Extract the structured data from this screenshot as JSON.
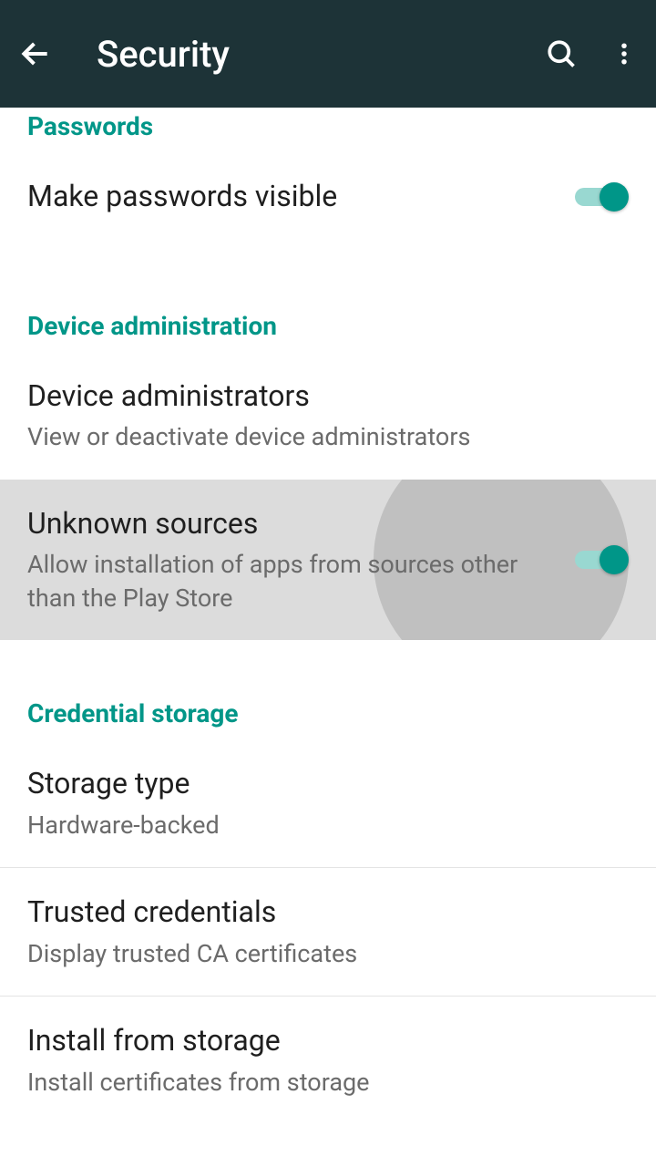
{
  "appbar": {
    "title": "Security"
  },
  "sections": {
    "passwords": {
      "header": "Passwords",
      "make_visible": {
        "title": "Make passwords visible",
        "checked": true
      }
    },
    "device_admin": {
      "header": "Device administration",
      "device_administrators": {
        "title": "Device administrators",
        "subtitle": "View or deactivate device administrators"
      },
      "unknown_sources": {
        "title": "Unknown sources",
        "subtitle": "Allow installation of apps from sources other than the Play Store",
        "checked": true
      }
    },
    "credential_storage": {
      "header": "Credential storage",
      "storage_type": {
        "title": "Storage type",
        "subtitle": "Hardware-backed"
      },
      "trusted_credentials": {
        "title": "Trusted credentials",
        "subtitle": "Display trusted CA certificates"
      },
      "install_from_storage": {
        "title": "Install from storage",
        "subtitle": "Install certificates from storage"
      }
    }
  }
}
